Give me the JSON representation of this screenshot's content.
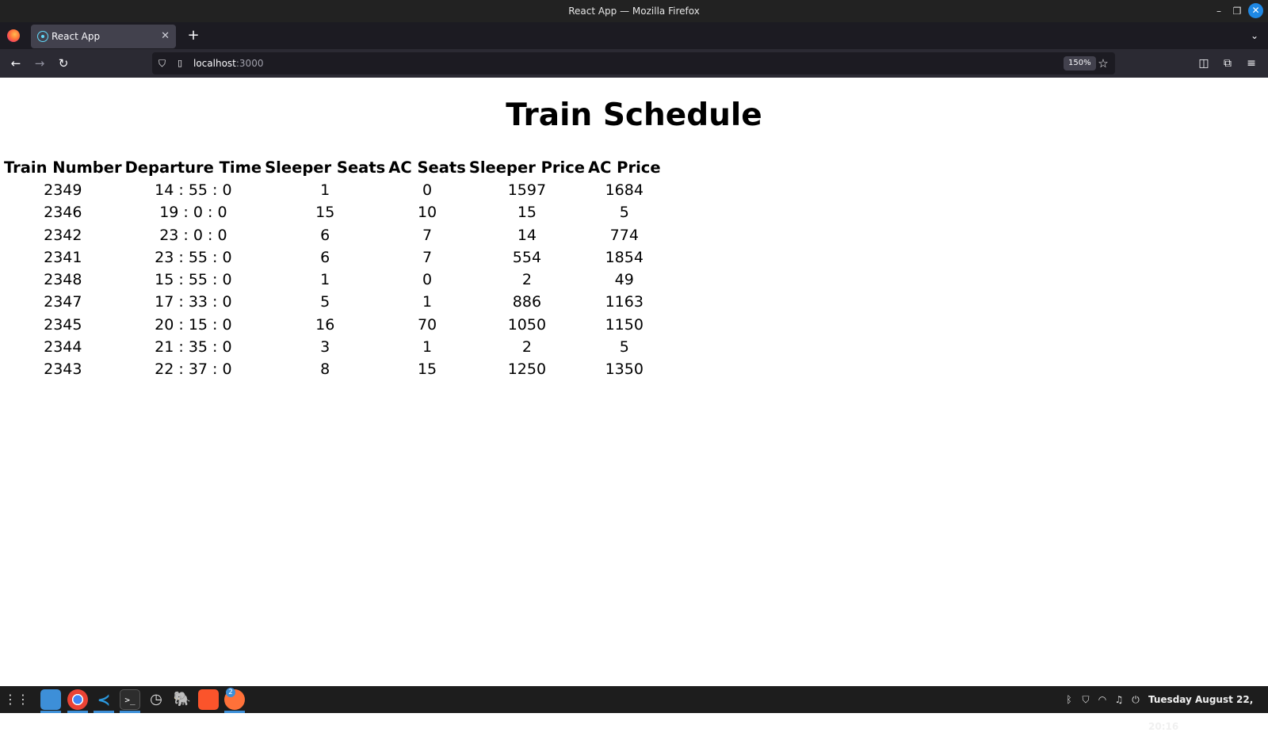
{
  "window": {
    "title": "React App — Mozilla Firefox",
    "minimize_glyph": "–",
    "maximize_glyph": "❐",
    "close_glyph": "✕"
  },
  "tabs": [
    {
      "label": "React App",
      "active": true,
      "close_glyph": "✕"
    }
  ],
  "tabstrip": {
    "new_tab_glyph": "+",
    "list_tabs_glyph": "⌄"
  },
  "navbar": {
    "back_glyph": "←",
    "forward_glyph": "→",
    "reload_glyph": "↻",
    "url_host": "localhost",
    "url_port": ":3000",
    "zoom": "150%",
    "bookmark_glyph": "☆",
    "pocket_glyph": "◫",
    "extensions_glyph": "⧉",
    "menu_glyph": "≡"
  },
  "page": {
    "heading": "Train Schedule",
    "columns": [
      "Train Number",
      "Departure Time",
      "Sleeper Seats",
      "AC Seats",
      "Sleeper Price",
      "AC Price"
    ],
    "rows": [
      [
        "2349",
        "14 : 55 : 0",
        "1",
        "0",
        "1597",
        "1684"
      ],
      [
        "2346",
        "19 : 0 : 0",
        "15",
        "10",
        "15",
        "5"
      ],
      [
        "2342",
        "23 : 0 : 0",
        "6",
        "7",
        "14",
        "774"
      ],
      [
        "2341",
        "23 : 55 : 0",
        "6",
        "7",
        "554",
        "1854"
      ],
      [
        "2348",
        "15 : 55 : 0",
        "1",
        "0",
        "2",
        "49"
      ],
      [
        "2347",
        "17 : 33 : 0",
        "5",
        "1",
        "886",
        "1163"
      ],
      [
        "2345",
        "20 : 15 : 0",
        "16",
        "70",
        "1050",
        "1150"
      ],
      [
        "2344",
        "21 : 35 : 0",
        "3",
        "1",
        "2",
        "5"
      ],
      [
        "2343",
        "22 : 37 : 0",
        "8",
        "15",
        "1250",
        "1350"
      ]
    ]
  },
  "taskbar": {
    "apps": [
      {
        "name": "apps-grid-icon",
        "glyph": "⋮⋮"
      },
      {
        "name": "files-icon",
        "glyph": ""
      },
      {
        "name": "chrome-icon",
        "glyph": ""
      },
      {
        "name": "vscode-icon",
        "glyph": "≺"
      },
      {
        "name": "terminal-icon",
        "glyph": ">_"
      },
      {
        "name": "timeshift-icon",
        "glyph": "◷"
      },
      {
        "name": "pgadmin-icon",
        "glyph": "🐘"
      },
      {
        "name": "brave-icon",
        "glyph": ""
      },
      {
        "name": "firefox-icon",
        "glyph": ""
      }
    ],
    "firefox_window_count": "2",
    "tray": {
      "bluetooth_glyph": "ᛒ",
      "vpn_glyph": "⛉",
      "wifi_glyph": "◠",
      "audio_glyph": "♫",
      "power_glyph": "⏻",
      "clock": "Tuesday August 22, 20:16"
    }
  }
}
